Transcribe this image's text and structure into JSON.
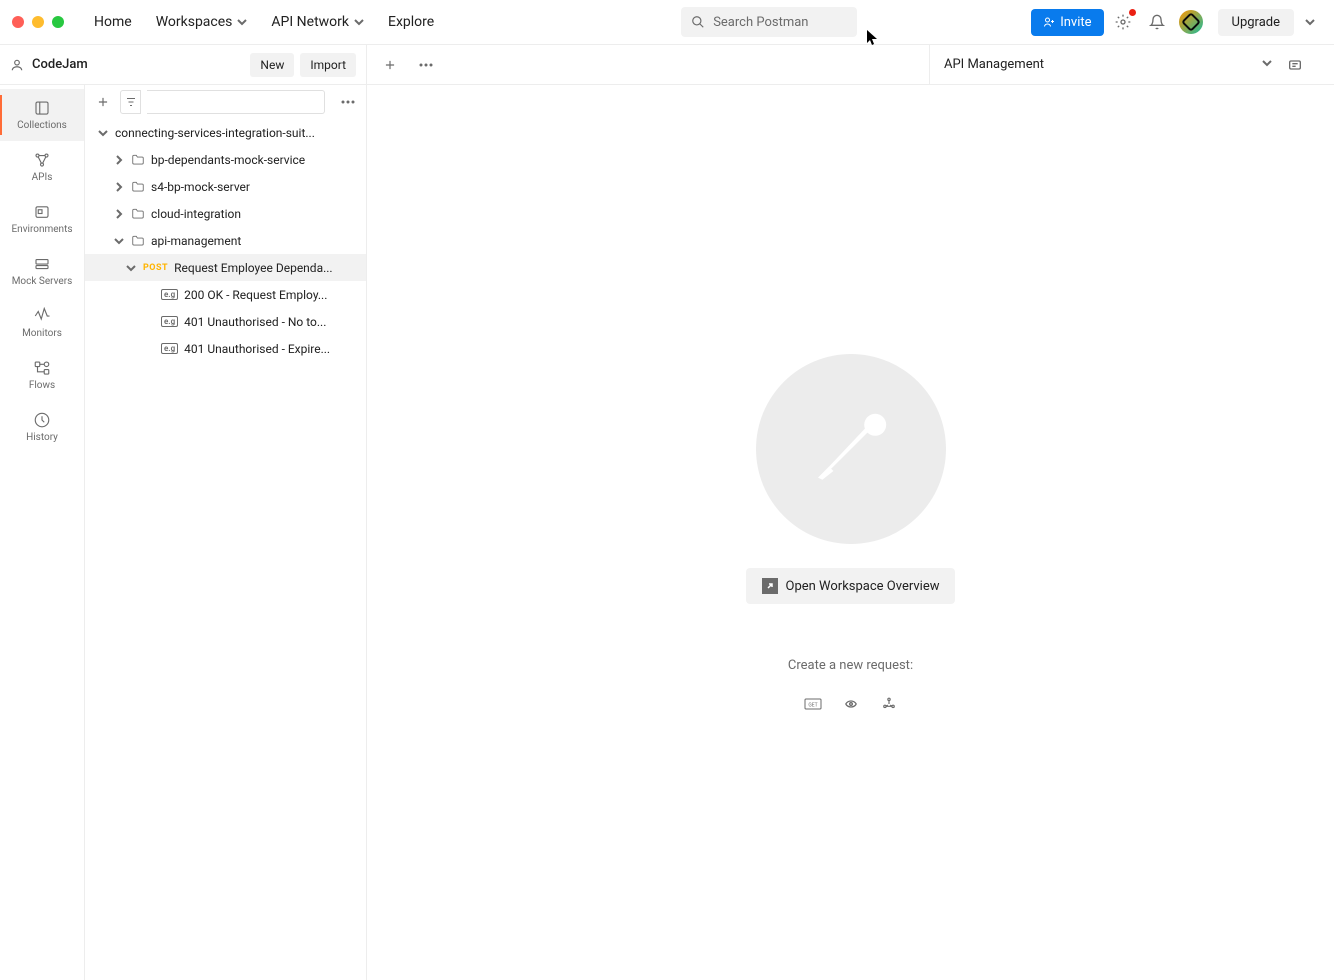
{
  "topnav": {
    "home": "Home",
    "workspaces": "Workspaces",
    "api_network": "API Network",
    "explore": "Explore",
    "search_placeholder": "Search Postman",
    "invite": "Invite",
    "upgrade": "Upgrade"
  },
  "workspace": {
    "name": "CodeJam",
    "new_btn": "New",
    "import_btn": "Import"
  },
  "environment": {
    "selected": "API Management"
  },
  "rail": {
    "items": [
      {
        "label": "Collections"
      },
      {
        "label": "APIs"
      },
      {
        "label": "Environments"
      },
      {
        "label": "Mock Servers"
      },
      {
        "label": "Monitors"
      },
      {
        "label": "Flows"
      },
      {
        "label": "History"
      }
    ]
  },
  "tree": {
    "root": "connecting-services-integration-suit...",
    "folders": [
      "bp-dependants-mock-service",
      "s4-bp-mock-server",
      "cloud-integration",
      "api-management"
    ],
    "request": {
      "method": "POST",
      "name": "Request Employee Dependa..."
    },
    "examples": [
      "200 OK - Request Employ...",
      "401 Unauthorised - No to...",
      "401 Unauthorised - Expire..."
    ]
  },
  "content": {
    "overview_btn": "Open Workspace Overview",
    "hint": "Create a new request:"
  }
}
